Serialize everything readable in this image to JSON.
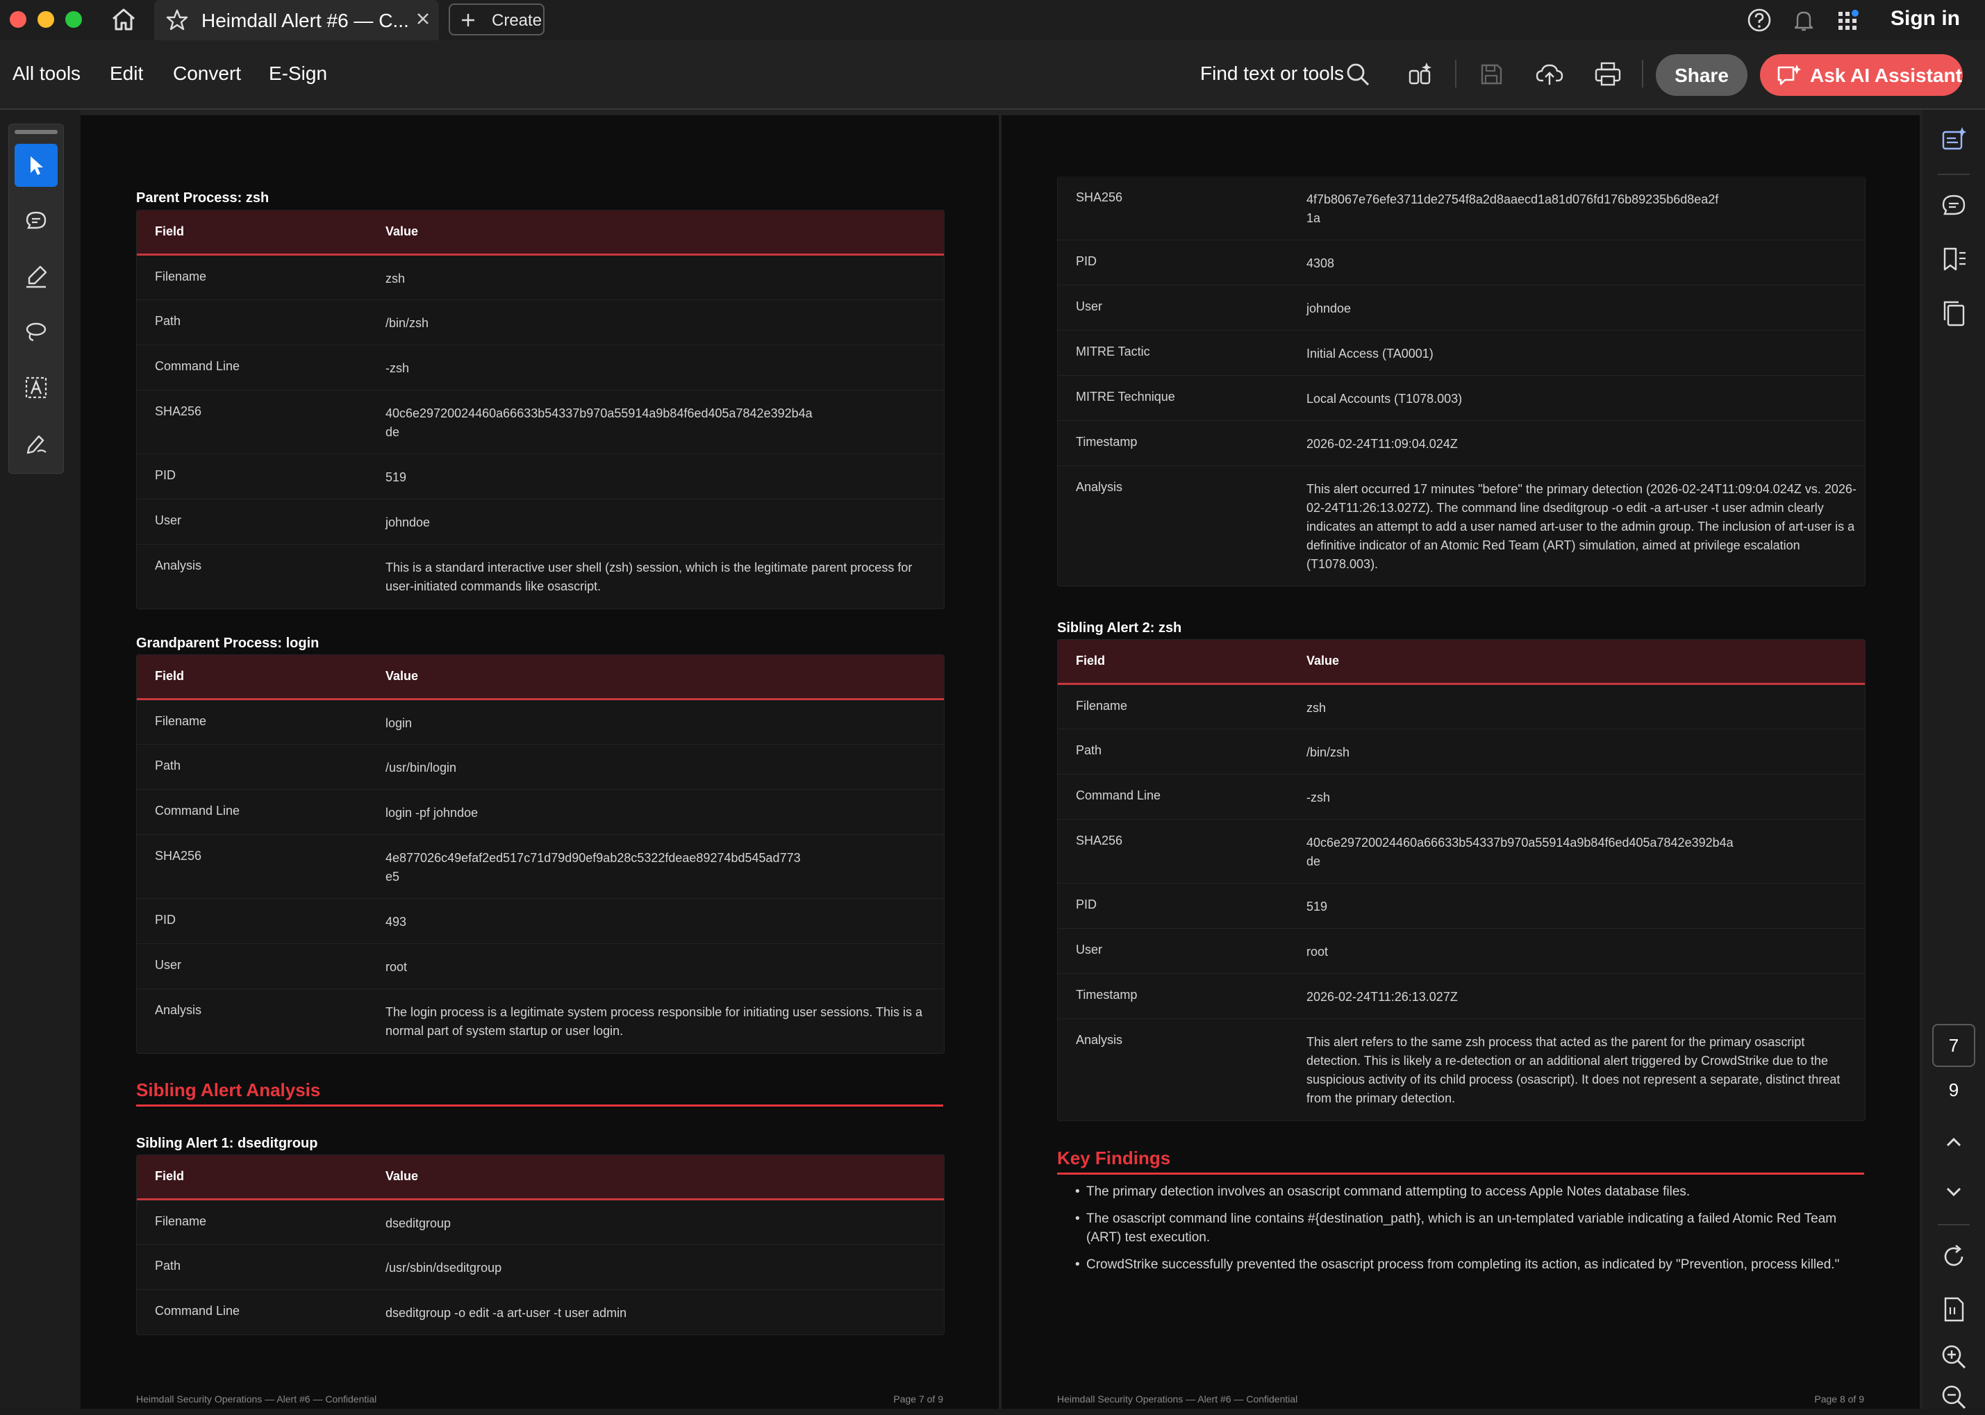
{
  "titlebar": {
    "tab_title": "Heimdall Alert #6 — C...",
    "create_label": "Create",
    "sign_in_label": "Sign in",
    "icons": [
      "home-icon",
      "star-icon",
      "close-icon",
      "plus-icon",
      "help-icon",
      "bell-icon",
      "apps-grid-icon"
    ],
    "traffic_lights": [
      "#ff5f57",
      "#febc2e",
      "#28c840"
    ]
  },
  "toolbar": {
    "menu": [
      "All tools",
      "Edit",
      "Convert",
      "E-Sign"
    ],
    "find_label": "Find text or tools",
    "share_label": "Share",
    "ai_label": "Ask AI Assistant",
    "icons": [
      "search-icon",
      "ai-tools-icon",
      "save-icon",
      "cloud-upload-icon",
      "print-icon",
      "ai-assistant-icon"
    ],
    "accent": "#ee5556"
  },
  "left_tools": [
    "select-tool",
    "comment-tool",
    "highlight-tool",
    "draw-tool",
    "text-select-tool",
    "sign-tool"
  ],
  "right_rail": {
    "current_page": "7",
    "total_pages": "9",
    "icons": [
      "ai-summary-icon",
      "comments-icon",
      "bookmark-icon",
      "pages-icon",
      "chevron-up-icon",
      "chevron-down-icon",
      "refresh-icon",
      "page-fit-icon",
      "zoom-in-icon",
      "zoom-out-icon"
    ]
  },
  "doc": {
    "accent_color": "#e8363c",
    "field_header": "Field",
    "value_header": "Value",
    "left": {
      "parent_heading": "Parent Process: zsh",
      "parent_rows": [
        {
          "f": "Filename",
          "v": "zsh"
        },
        {
          "f": "Path",
          "v": "/bin/zsh"
        },
        {
          "f": "Command Line",
          "v": "-zsh"
        },
        {
          "f": "SHA256",
          "v": "40c6e29720024460a66633b54337b970a55914a9b84f6ed405a7842e392b4a\nde"
        },
        {
          "f": "PID",
          "v": "519"
        },
        {
          "f": "User",
          "v": "johndoe"
        },
        {
          "f": "Analysis",
          "v": "This is a standard interactive user shell (zsh) session, which is the legitimate parent process for user-initiated commands like osascript."
        }
      ],
      "grandparent_heading": "Grandparent Process: login",
      "grandparent_rows": [
        {
          "f": "Filename",
          "v": "login"
        },
        {
          "f": "Path",
          "v": "/usr/bin/login"
        },
        {
          "f": "Command Line",
          "v": "login -pf johndoe"
        },
        {
          "f": "SHA256",
          "v": "4e877026c49efaf2ed517c71d79d90ef9ab28c5322fdeae89274bd545ad773\ne5"
        },
        {
          "f": "PID",
          "v": "493"
        },
        {
          "f": "User",
          "v": "root"
        },
        {
          "f": "Analysis",
          "v": "The login process is a legitimate system process responsible for initiating user sessions. This is a normal part of system startup or user login."
        }
      ],
      "sibling_section": "Sibling Alert Analysis",
      "sibling1_heading": "Sibling Alert 1: dseditgroup",
      "sibling1_rows": [
        {
          "f": "Filename",
          "v": "dseditgroup"
        },
        {
          "f": "Path",
          "v": "/usr/sbin/dseditgroup"
        },
        {
          "f": "Command Line",
          "v": "dseditgroup -o edit -a art-user -t user admin"
        }
      ],
      "footer_left": "Heimdall Security Operations — Alert #6 — Confidential",
      "footer_right": "Page 7 of 9"
    },
    "right": {
      "sibling1_cont_rows": [
        {
          "f": "SHA256",
          "v": "4f7b8067e76efe3711de2754f8a2d8aaecd1a81d076fd176b89235b6d8ea2f\n1a"
        },
        {
          "f": "PID",
          "v": "4308"
        },
        {
          "f": "User",
          "v": "johndoe"
        },
        {
          "f": "MITRE Tactic",
          "v": "Initial Access (TA0001)"
        },
        {
          "f": "MITRE Technique",
          "v": "Local Accounts (T1078.003)"
        },
        {
          "f": "Timestamp",
          "v": "2026-02-24T11:09:04.024Z"
        },
        {
          "f": "Analysis",
          "v": "This alert occurred 17 minutes \"before\" the primary detection (2026-02-24T11:09:04.024Z vs. 2026-02-24T11:26:13.027Z). The command line dseditgroup -o edit -a art-user -t user admin clearly indicates an attempt to add a user named art-user to the admin group. The inclusion of art-user is a definitive indicator of an Atomic Red Team (ART) simulation, aimed at privilege escalation (T1078.003)."
        }
      ],
      "sibling2_heading": "Sibling Alert 2: zsh",
      "sibling2_rows": [
        {
          "f": "Filename",
          "v": "zsh"
        },
        {
          "f": "Path",
          "v": "/bin/zsh"
        },
        {
          "f": "Command Line",
          "v": "-zsh"
        },
        {
          "f": "SHA256",
          "v": "40c6e29720024460a66633b54337b970a55914a9b84f6ed405a7842e392b4a\nde"
        },
        {
          "f": "PID",
          "v": "519"
        },
        {
          "f": "User",
          "v": "root"
        },
        {
          "f": "Timestamp",
          "v": "2026-02-24T11:26:13.027Z"
        },
        {
          "f": "Analysis",
          "v": "This alert refers to the same zsh process that acted as the parent for the primary osascript detection. This is likely a re-detection or an additional alert triggered by CrowdStrike due to the suspicious activity of its child process (osascript). It does not represent a separate, distinct threat from the primary detection."
        }
      ],
      "key_findings_heading": "Key Findings",
      "key_findings": [
        "The primary detection involves an osascript command attempting to access Apple Notes database files.",
        "The osascript command line contains #{destination_path}, which is an un-templated variable indicating a failed Atomic Red Team (ART) test execution.",
        "CrowdStrike successfully prevented the osascript process from completing its action, as indicated by \"Prevention, process killed.\""
      ],
      "footer_left": "Heimdall Security Operations — Alert #6 — Confidential",
      "footer_right": "Page 8 of 9"
    }
  }
}
